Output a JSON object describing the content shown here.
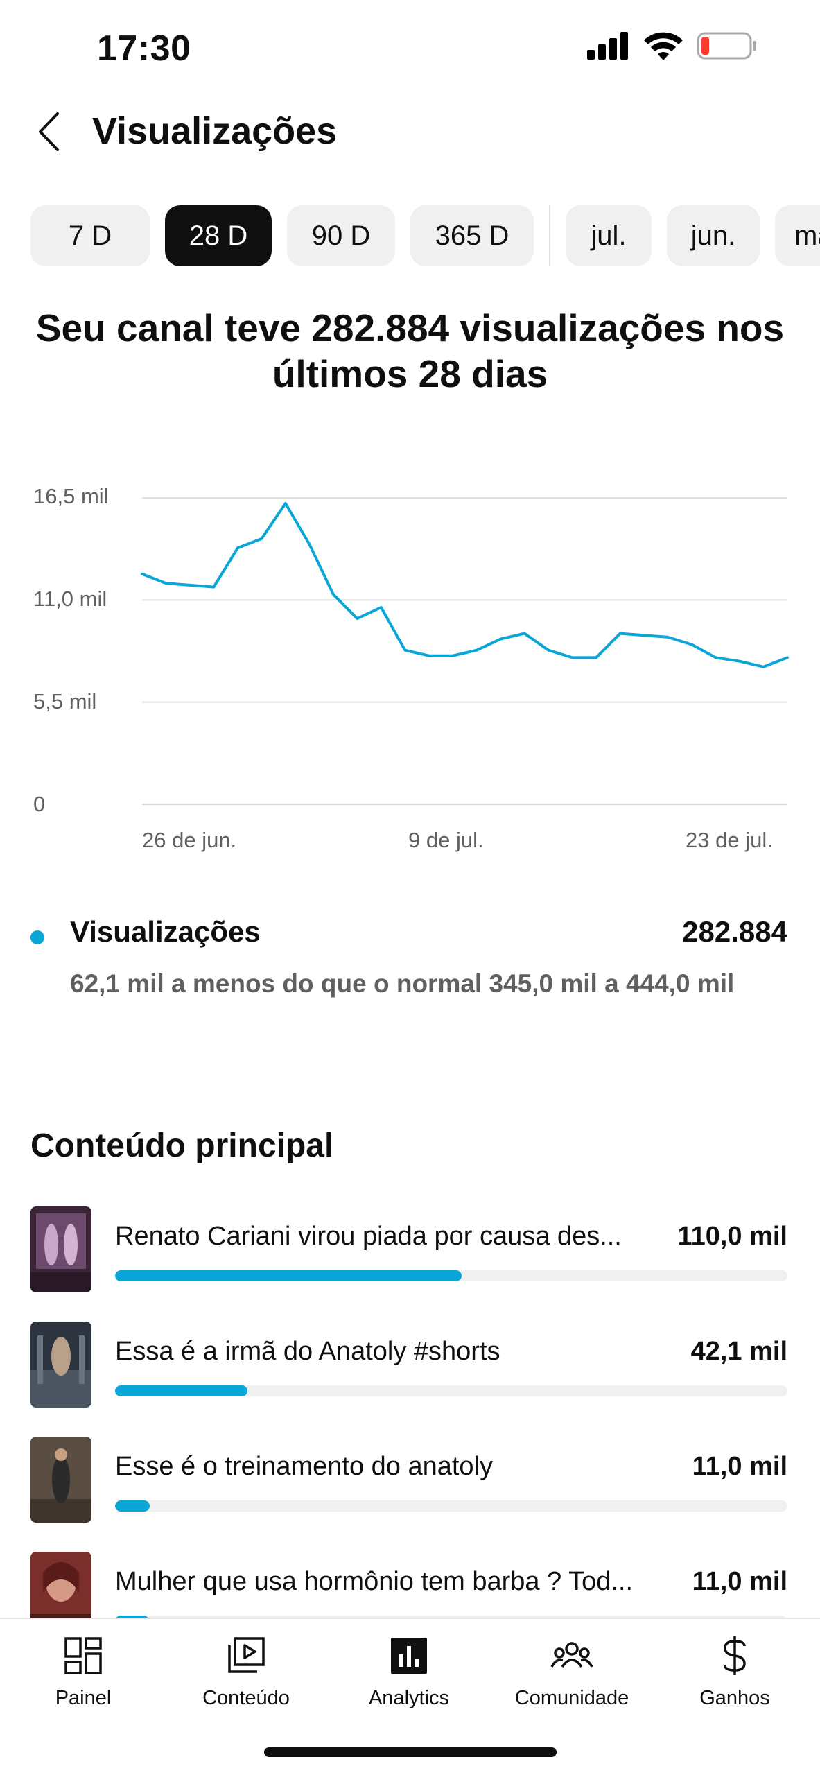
{
  "status_bar": {
    "time": "17:30"
  },
  "header": {
    "title": "Visualizações"
  },
  "period_chips": [
    {
      "label": "7 D",
      "selected": false
    },
    {
      "label": "28 D",
      "selected": true
    },
    {
      "label": "90 D",
      "selected": false
    },
    {
      "label": "365 D",
      "selected": false
    },
    {
      "label": "jul.",
      "selected": false
    },
    {
      "label": "jun.",
      "selected": false
    },
    {
      "label": "mai",
      "selected": false
    }
  ],
  "summary": {
    "text": "Seu canal teve 282.884 visualizações nos últimos 28 dias"
  },
  "colors": {
    "accent": "#0aa6d8",
    "track": "#f0f0f0",
    "grid": "#e0e0e0",
    "secondary_text": "#606060"
  },
  "chart_data": {
    "type": "line",
    "x_tick_labels": [
      "26 de jun.",
      "9 de jul.",
      "23 de jul."
    ],
    "y_tick_labels": [
      "16,5 mil",
      "11,0 mil",
      "5,5 mil",
      "0"
    ],
    "y_ticks": [
      16500,
      11000,
      5500,
      0
    ],
    "ylim": [
      0,
      16500
    ],
    "grid": true,
    "series": [
      {
        "name": "Visualizações",
        "values": [
          12400,
          11900,
          11800,
          11700,
          13800,
          14300,
          16200,
          14000,
          11300,
          10000,
          10600,
          8300,
          8000,
          8000,
          8300,
          8900,
          9200,
          8300,
          7900,
          7900,
          9200,
          9100,
          9000,
          8600,
          7900,
          7700,
          7400,
          7900
        ]
      }
    ]
  },
  "legend": {
    "name": "Visualizações",
    "total": "282.884",
    "note": "62,1 mil a menos do que o normal 345,0 mil a 444,0 mil"
  },
  "top_content": {
    "title": "Conteúdo principal",
    "items": [
      {
        "title": "Renato Cariani virou piada por causa des...",
        "value": "110,0 mil",
        "fraction": 0.515
      },
      {
        "title": "Essa é a irmã do Anatoly #shorts",
        "value": "42,1 mil",
        "fraction": 0.197
      },
      {
        "title": "Esse é o treinamento do anatoly",
        "value": "11,0 mil",
        "fraction": 0.052
      },
      {
        "title": "Mulher que usa hormônio tem barba ? Tod...",
        "value": "11,0 mil",
        "fraction": 0.05
      }
    ]
  },
  "bottom_nav": [
    {
      "label": "Painel",
      "icon": "dashboard-icon",
      "active": false
    },
    {
      "label": "Conteúdo",
      "icon": "content-icon",
      "active": false
    },
    {
      "label": "Analytics",
      "icon": "analytics-icon",
      "active": true
    },
    {
      "label": "Comunidade",
      "icon": "community-icon",
      "active": false
    },
    {
      "label": "Ganhos",
      "icon": "earnings-icon",
      "active": false
    }
  ]
}
